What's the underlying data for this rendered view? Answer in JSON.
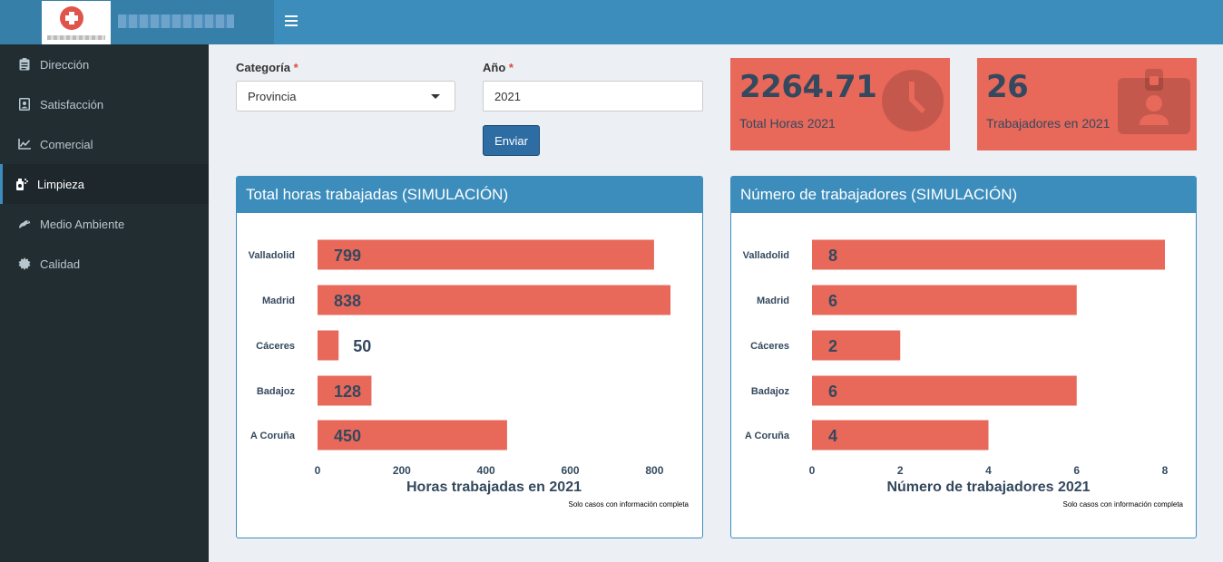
{
  "header": {
    "menu_icon": "hamburger-icon"
  },
  "sidebar": {
    "items": [
      {
        "label": "Dirección",
        "icon": "clipboard-icon",
        "active": false
      },
      {
        "label": "Satisfacción",
        "icon": "id-badge-icon",
        "active": false
      },
      {
        "label": "Comercial",
        "icon": "line-chart-icon",
        "active": false
      },
      {
        "label": "Limpieza",
        "icon": "cleaning-icon",
        "active": true
      },
      {
        "label": "Medio Ambiente",
        "icon": "frog-icon",
        "active": false
      },
      {
        "label": "Calidad",
        "icon": "gear-badge-icon",
        "active": false
      }
    ]
  },
  "form": {
    "categoria_label": "Categoría",
    "required_mark": "*",
    "categoria_value": "Provincia",
    "anio_label": "Año",
    "anio_value": "2021",
    "submit_label": "Enviar"
  },
  "value_boxes": [
    {
      "value": "2264.71",
      "label": "Total Horas 2021",
      "icon": "clock-icon"
    },
    {
      "value": "26",
      "label": "Trabajadores en 2021",
      "icon": "id-badge-icon"
    }
  ],
  "colors": {
    "header": "#3c8dbc",
    "sidebar": "#222d32",
    "bar": "#e8685a",
    "text_dark": "#34495e"
  },
  "chart_data": [
    {
      "type": "bar",
      "orientation": "horizontal",
      "title": "Total horas trabajadas (SIMULACIÓN)",
      "categories": [
        "Valladolid",
        "Madrid",
        "Cáceres",
        "Badajoz",
        "A Coruña"
      ],
      "values": [
        799,
        838,
        50,
        128,
        450
      ],
      "value_labels": [
        "799",
        "838",
        "50",
        "128",
        "450"
      ],
      "xlabel": "Horas trabajadas en 2021",
      "xlim": [
        0,
        838
      ],
      "xticks": [
        0,
        200,
        400,
        600,
        800
      ],
      "xtick_labels": [
        "0",
        "200",
        "400",
        "600",
        "800"
      ],
      "caption": "Solo casos con información completa"
    },
    {
      "type": "bar",
      "orientation": "horizontal",
      "title": "Número de trabajadores (SIMULACIÓN)",
      "categories": [
        "Valladolid",
        "Madrid",
        "Cáceres",
        "Badajoz",
        "A Coruña"
      ],
      "values": [
        8,
        6,
        2,
        6,
        4
      ],
      "value_labels": [
        "8",
        "6",
        "2",
        "6",
        "4"
      ],
      "xlabel": "Número de trabajadores 2021",
      "xlim": [
        0,
        8
      ],
      "xticks": [
        0,
        2,
        4,
        6,
        8
      ],
      "xtick_labels": [
        "0",
        "2",
        "4",
        "6",
        "8"
      ],
      "caption": "Solo casos con información completa"
    }
  ]
}
